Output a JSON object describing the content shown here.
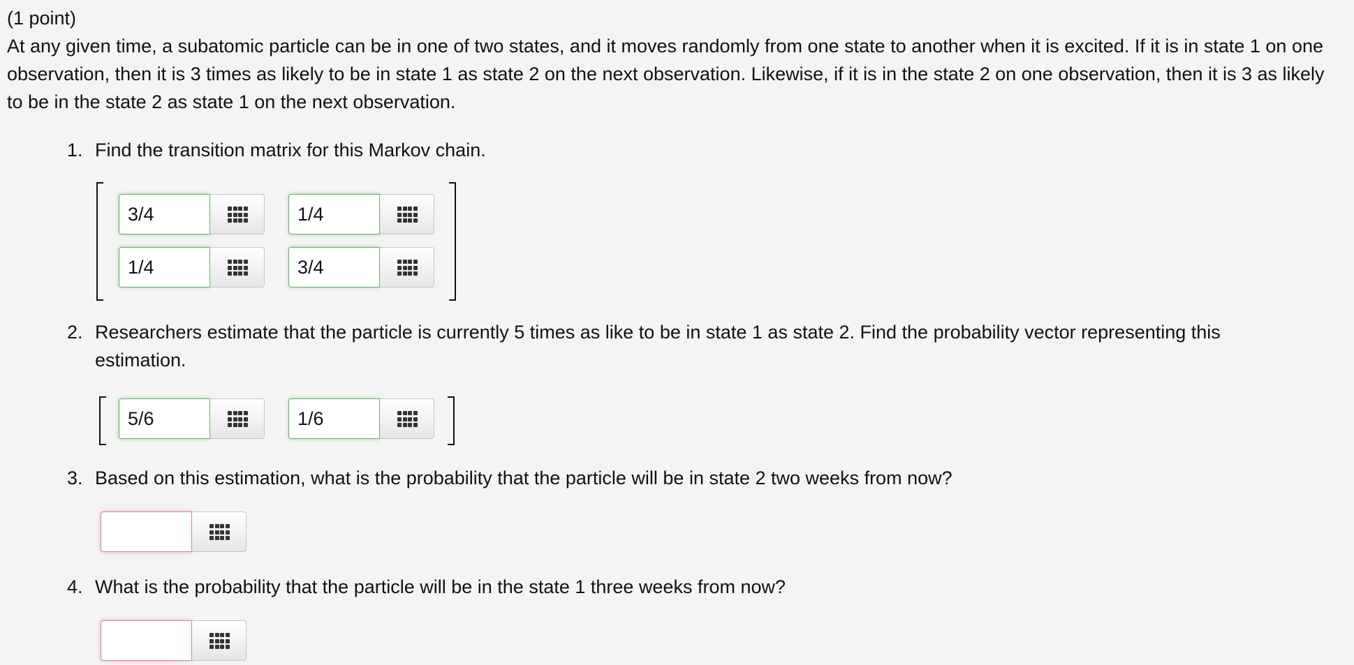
{
  "header": {
    "points": "(1 point)",
    "intro": "At any given time, a subatomic particle can be in one of two states, and it moves randomly from one state to another when it is excited. If it is in state 1 on one observation, then it is 3 times as likely to be in state 1 as state 2 on the next observation. Likewise, if it is in the state 2 on one observation, then it is 3 as likely to be in the state 2 as state 1 on the next observation."
  },
  "questions": [
    {
      "number": "1.",
      "text": "Find the transition matrix for this Markov chain.",
      "answers": [
        "3/4",
        "1/4",
        "1/4",
        "3/4"
      ]
    },
    {
      "number": "2.",
      "text": "Researchers estimate that the particle is currently 5 times as like to be in state 1 as state 2. Find the probability vector representing this estimation.",
      "answers": [
        "5/6",
        "1/6"
      ]
    },
    {
      "number": "3.",
      "text": "Based on this estimation, what is the probability that the particle will be in state 2 two weeks from now?",
      "answers": [
        ""
      ]
    },
    {
      "number": "4.",
      "text": "What is the probability that the particle will be in the state 1 three weeks from now?",
      "answers": [
        ""
      ]
    }
  ],
  "icons": {
    "equation_editor": "grid-icon"
  },
  "colors": {
    "correct_border": "#6fab6f",
    "incorrect_border": "#d48a8a",
    "background": "#f4f4f4"
  }
}
